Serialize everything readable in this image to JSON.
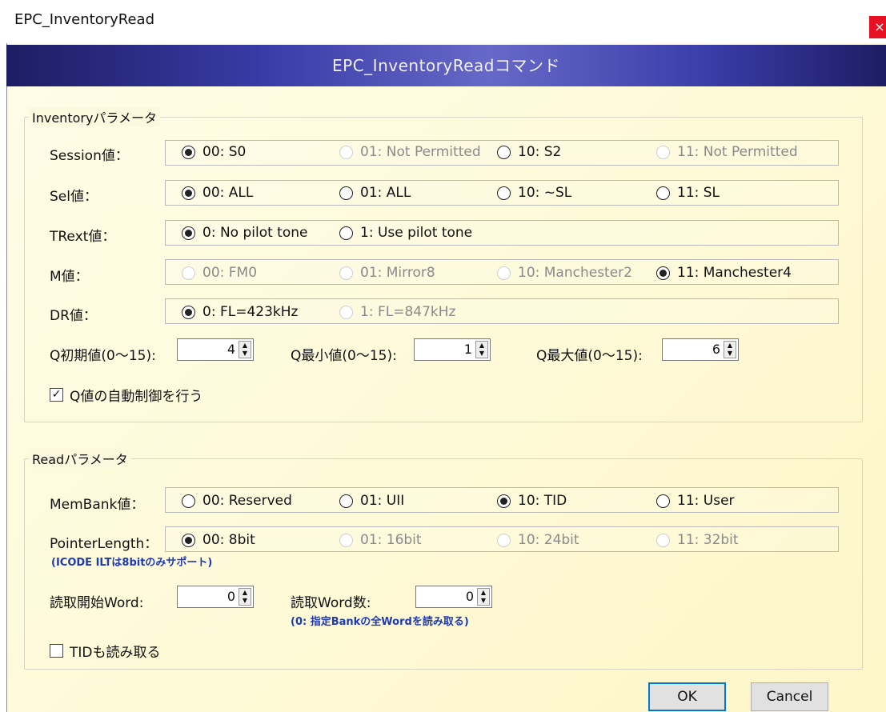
{
  "window": {
    "title": "EPC_InventoryRead",
    "close_glyph": "×"
  },
  "banner": {
    "text": "EPC_InventoryReadコマンド"
  },
  "inventory": {
    "group_label": "Inventoryパラメータ",
    "session": {
      "label": "Session値：",
      "options": [
        "00: S0",
        "01: Not Permitted",
        "10: S2",
        "11: Not Permitted"
      ]
    },
    "sel": {
      "label": "Sel値：",
      "options": [
        "00: ALL",
        "01: ALL",
        "10: ~SL",
        "11: SL"
      ]
    },
    "trext": {
      "label": "TRext値：",
      "options": [
        "0: No pilot tone",
        "1: Use pilot tone"
      ]
    },
    "m": {
      "label": "M値：",
      "options": [
        "00: FM0",
        "01: Mirror8",
        "10: Manchester2",
        "11: Manchester4"
      ]
    },
    "dr": {
      "label": "DR値：",
      "options": [
        "0: FL=423kHz",
        "1: FL=847kHz"
      ]
    },
    "q_initial": {
      "label": "Q初期値(0〜15):",
      "value": "4"
    },
    "q_min": {
      "label": "Q最小値(0〜15):",
      "value": "1"
    },
    "q_max": {
      "label": "Q最大値(0〜15):",
      "value": "6"
    },
    "auto_q": {
      "label": "Q値の自動制御を行う",
      "checked_glyph": "✓"
    }
  },
  "read": {
    "group_label": "Readパラメータ",
    "membank": {
      "label": "MemBank値：",
      "options": [
        "00: Reserved",
        "01: UII",
        "10: TID",
        "11: User"
      ]
    },
    "pointer": {
      "label": "PointerLength：",
      "options": [
        "00: 8bit",
        "01: 16bit",
        "10: 24bit",
        "11: 32bit"
      ],
      "note": "(ICODE ILTは8bitのみサポート)"
    },
    "start_word": {
      "label": "読取開始Word:",
      "value": "0"
    },
    "word_count": {
      "label": "読取Word数:",
      "value": "0",
      "note": "(0: 指定Bankの全Wordを読み取る)"
    },
    "read_tid": {
      "label": "TIDも読み取る"
    }
  },
  "buttons": {
    "ok": "OK",
    "cancel": "Cancel"
  },
  "arrow_glyphs": {
    "up": "▲",
    "down": "▼"
  }
}
